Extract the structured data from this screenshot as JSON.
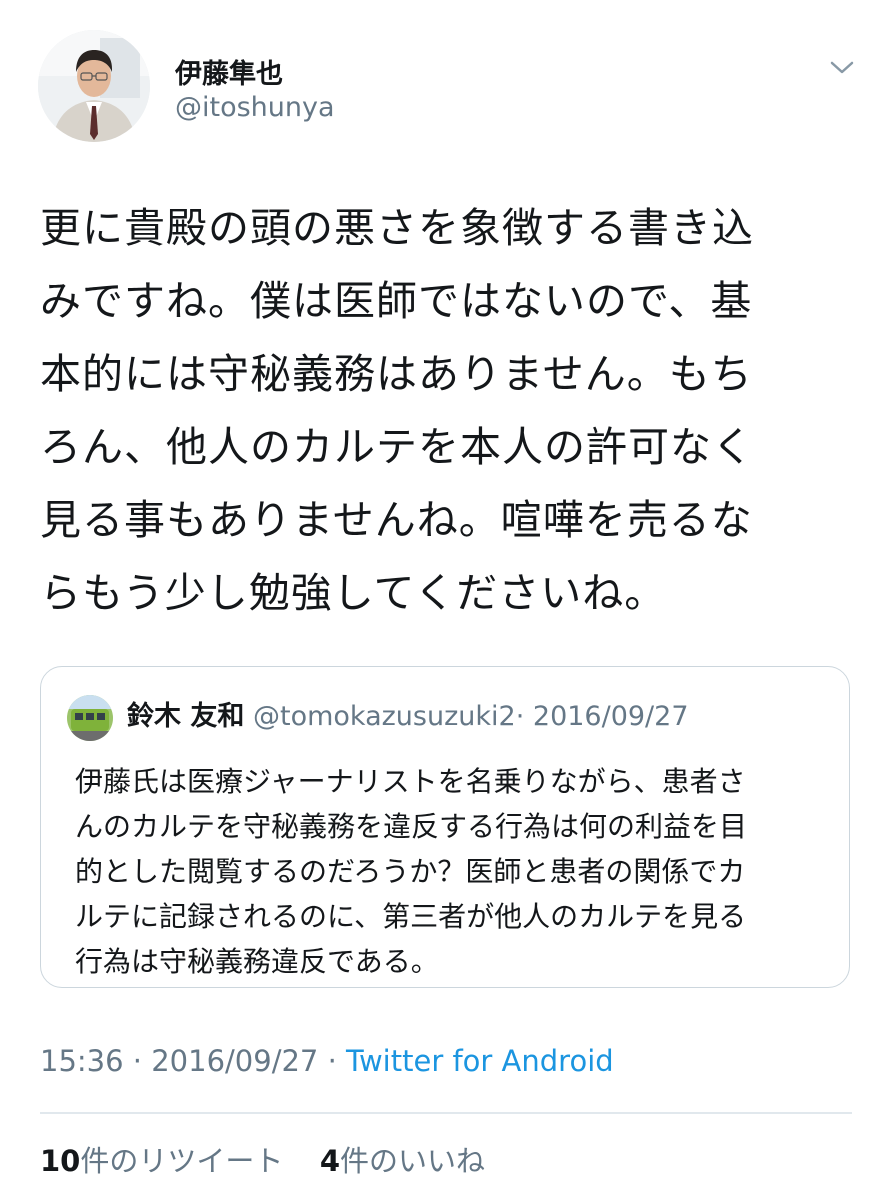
{
  "author": {
    "display_name": "伊藤隼也",
    "handle": "@itoshunya"
  },
  "tweet": {
    "text_lines": [
      "更に貴殿の頭の悪さを象徴する書き込",
      "みですね。僕は医師ではないので、基",
      "本的には守秘義務はありません。もち",
      "ろん、他人のカルテを本人の許可なく",
      "見る事もありませんね。喧嘩を売るな",
      "らもう少し勉強してくださいね。"
    ]
  },
  "quoted_tweet": {
    "display_name": "鈴木 友和",
    "handle": "@tomokazusuzuki2",
    "separator": "·",
    "date": "2016/09/27",
    "text_lines": [
      "伊藤氏は医療ジャーナリストを名乗りながら、患者さ",
      "んのカルテを守秘義務を違反する行為は何の利益を目",
      "的とした閲覧するのだろうか？医師と患者の関係でカ",
      "ルテに記録されるのに、第三者が他人のカルテを見る",
      "行為は守秘義務違反である。"
    ]
  },
  "meta": {
    "time": "15:36",
    "separator": "·",
    "date": "2016/09/27",
    "via": "Twitter for Android"
  },
  "stats": {
    "retweets_count": "10",
    "retweets_label": "件のリツイート",
    "likes_count": "4",
    "likes_label": "件のいいね"
  },
  "icons": {
    "menu": "chevron-down-icon"
  },
  "colors": {
    "text": "#14171a",
    "secondary": "#657786",
    "link": "#1b95e0",
    "border": "#ccd6dd",
    "divider": "#e1e8ed"
  }
}
